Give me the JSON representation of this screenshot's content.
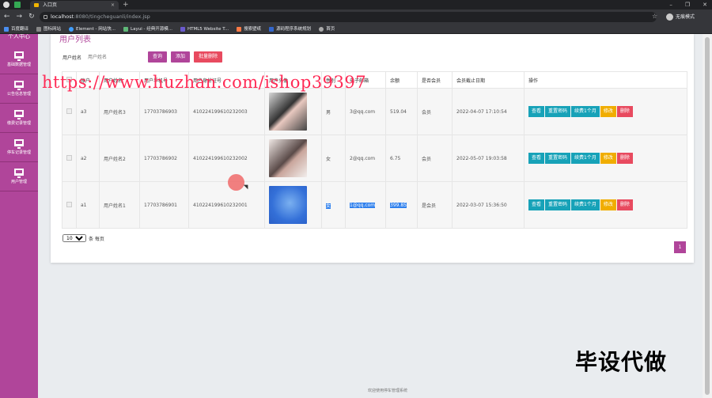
{
  "browser": {
    "tab_title": "入口页",
    "url_host": "localhost",
    "url_path": ":8080/tingcheguanli/index.jsp",
    "profile_label": "无痕模式",
    "bookmarks": [
      "百度翻译",
      "图标网站",
      "Element - 网站快...",
      "Layui - 经典开源模...",
      "HTML5 Website T...",
      "搜索壁纸",
      "源码程序系统规划",
      "首页"
    ]
  },
  "sidebar": {
    "top_label": "个人中心",
    "items": [
      {
        "label": "基础数据管理"
      },
      {
        "label": "公告信息管理"
      },
      {
        "label": "缴费记录管理"
      },
      {
        "label": "停车记录管理"
      },
      {
        "label": "用户管理"
      }
    ]
  },
  "main": {
    "title": "用户列表",
    "search_label": "用户姓名",
    "search_placeholder": "用户姓名",
    "btn_search": "查询",
    "btn_add": "添加",
    "btn_batch_delete": "批量删除",
    "columns": [
      "账户",
      "用户姓名",
      "用户手机号",
      "用户身份证号",
      "用户头像",
      "性别",
      "电子邮箱",
      "余额",
      "是否会员",
      "会员截止日期",
      "操作"
    ],
    "rows": [
      {
        "account": "a3",
        "name": "用户姓名3",
        "phone": "17703786903",
        "idcard": "410224199610232003",
        "gender": "男",
        "email": "3@qq.com",
        "balance": "519.04",
        "member": "会员",
        "expire": "2022-04-07 17:10:54"
      },
      {
        "account": "a2",
        "name": "用户姓名2",
        "phone": "17703786902",
        "idcard": "410224199610232002",
        "gender": "女",
        "email": "2@qq.com",
        "balance": "6.75",
        "member": "会员",
        "expire": "2022-05-07 19:03:58"
      },
      {
        "account": "a1",
        "name": "用户姓名1",
        "phone": "17703786901",
        "idcard": "410224199610232001",
        "gender": "女",
        "email": "1@qq.com",
        "balance": "399.85",
        "member": "是会员",
        "expire": "2022-03-07 15:36:50"
      }
    ],
    "ops": {
      "view": "查看",
      "reset": "重置密码",
      "renew": "续费1个月",
      "edit": "修改",
      "delete": "删除"
    },
    "page_size": "10",
    "page_size_suffix": "条 每页",
    "current_page": "1"
  },
  "watermark": "https://www.huzhan.com/ishop39397",
  "corner_text": "毕设代做",
  "footer": "欢迎使用停车管理系统"
}
